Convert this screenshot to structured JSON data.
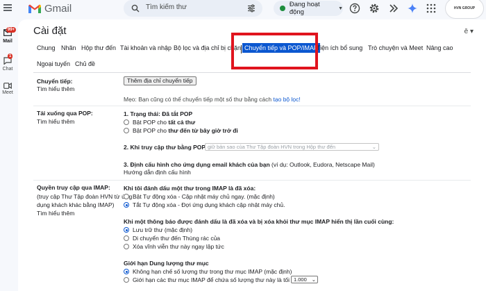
{
  "app": {
    "name": "Gmail"
  },
  "search": {
    "placeholder": "Tìm kiếm thư"
  },
  "status": {
    "label": "Đang hoạt động"
  },
  "avatar": {
    "label": "HVN GROUP"
  },
  "rail": {
    "mail_badge": "99+",
    "mail": "Mail",
    "chat_badge": "1",
    "chat": "Chat",
    "meet": "Meet"
  },
  "page": {
    "title": "Cài đặt",
    "lang_icon": "ē"
  },
  "tabs": [
    {
      "label": "Chung"
    },
    {
      "label": "Nhãn"
    },
    {
      "label": "Hộp thư đến"
    },
    {
      "label": "Tài khoản và nhập"
    },
    {
      "label": "Bộ lọc và địa chỉ bị chặn"
    },
    {
      "label": "Chuyển tiếp và POP/IMAP"
    },
    {
      "label": "Tiện ích bổ sung"
    },
    {
      "label": "Trò chuyện và Meet"
    },
    {
      "label": "Nâng cao"
    },
    {
      "label": "Ngoại tuyến"
    },
    {
      "label": "Chủ đề"
    }
  ],
  "forwarding": {
    "label": "Chuyển tiếp:",
    "learn_more": "Tìm hiểu thêm",
    "button": "Thêm địa chỉ chuyển tiếp",
    "tip": "Mẹo: Bạn cũng có thể chuyển tiếp một số thư bằng cách",
    "tip_link": "tạo bộ lọc!"
  },
  "pop": {
    "label": "Tải xuống qua POP:",
    "learn_more": "Tìm hiểu thêm",
    "status_title": "1. Trạng thái: Đã tắt POP",
    "opt1_prefix": "Bật POP cho",
    "opt1_bold": "tất cả thư",
    "opt2_prefix": "Bật POP cho",
    "opt2_bold": "thư đến từ bây giờ trở đi",
    "access_title": "2. Khi truy cập thư bằng POP",
    "access_select": "giữ bản sao của Thư Tập đoàn HVN trong Hộp thư đến",
    "client_title": "3. Định cấu hình cho ứng dụng email khách của bạn",
    "client_note": "(ví dụ: Outlook, Eudora, Netscape Mail)",
    "client_link": "Hướng dẫn định cấu hình"
  },
  "imap": {
    "label": "Quyền truy cập qua IMAP:",
    "desc1": "(truy cập Thư Tập đoàn HVN từ ứng",
    "desc2": "dụng khách khác bằng IMAP)",
    "learn_more": "Tìm hiểu thêm",
    "q1": "Khi tôi đánh dấu một thư trong IMAP là đã xóa:",
    "q1_opt1": "Bật Tự động xóa - Cập nhật máy chủ ngay. (mặc định)",
    "q1_opt2": "Tắt Tự động xóa - Đợi ứng dụng khách cập nhật máy chủ.",
    "q2": "Khi một thông báo được đánh dấu là đã xóa và bị xóa khỏi thư mục IMAP hiển thị lần cuối cùng:",
    "q2_opt1": "Lưu trữ thư (mặc định)",
    "q2_opt2": "Di chuyển thư đến Thùng rác của",
    "q2_opt3": "Xóa vĩnh viễn thư này ngay lập tức",
    "q3": "Giới hạn Dung lượng thư mục",
    "q3_opt1": "Không hạn chế số lượng thư trong thư mục IMAP (mặc định)",
    "q3_opt2": "Giới hạn các thư mục IMAP để chứa số lượng thư này là tối đa",
    "q3_select": "1.000"
  }
}
